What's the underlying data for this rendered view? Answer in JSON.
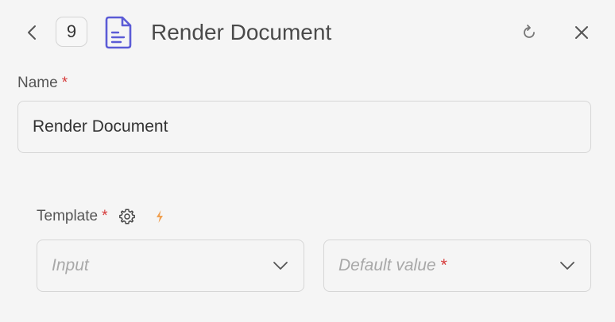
{
  "header": {
    "step_number": "9",
    "title": "Render Document"
  },
  "name_field": {
    "label": "Name",
    "required_mark": "*",
    "value": "Render Document"
  },
  "template_field": {
    "label": "Template",
    "required_mark": "*",
    "input_select": {
      "placeholder": "Input"
    },
    "default_select": {
      "placeholder": "Default value",
      "required_mark": "*"
    }
  },
  "colors": {
    "accent": "#5b5bd6",
    "required": "#d63a3a",
    "bolt": "#f0a050",
    "border": "#d6d6d6",
    "background": "#f5f5f5"
  },
  "icons": {
    "back": "chevron-left-icon",
    "document": "document-icon",
    "refresh": "refresh-icon",
    "close": "close-icon",
    "settings": "gear-icon",
    "dynamic": "lightning-icon",
    "dropdown": "chevron-down-icon"
  }
}
